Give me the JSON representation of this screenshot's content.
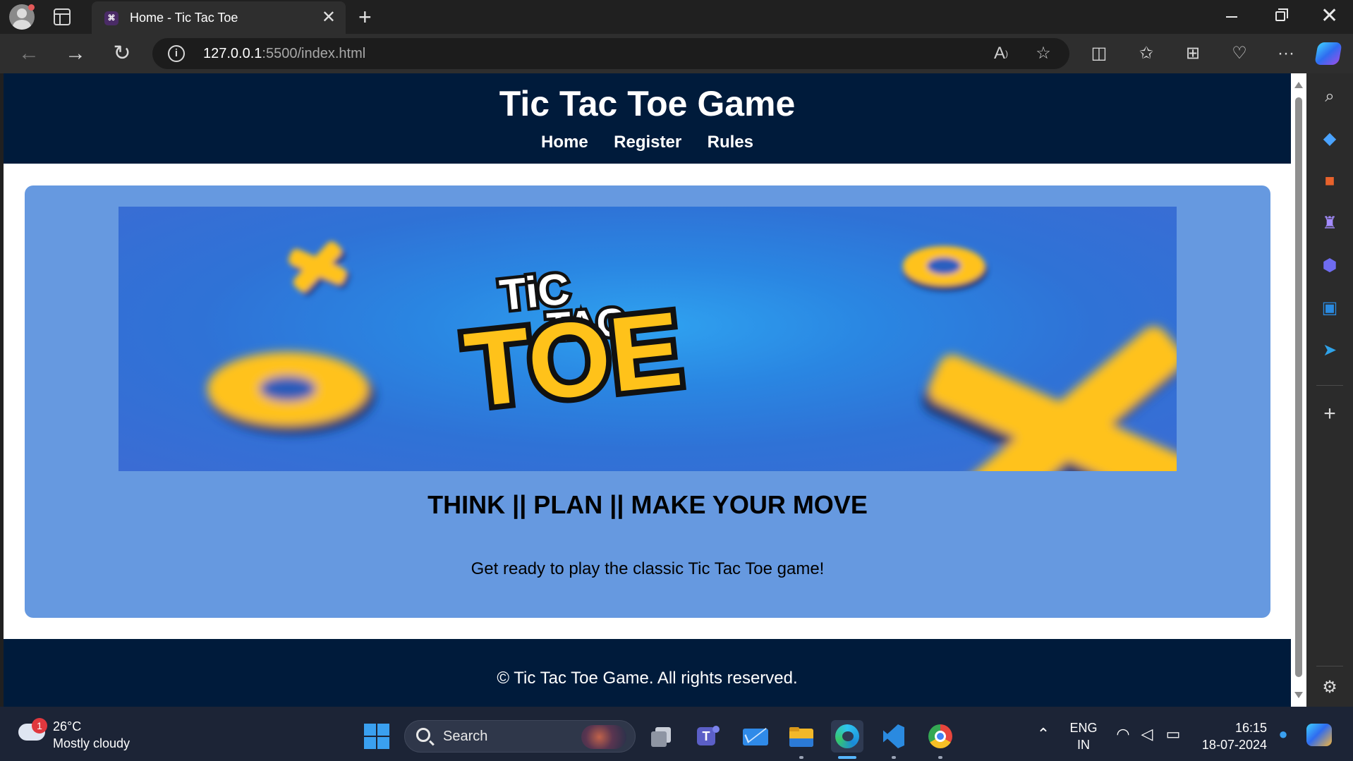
{
  "browser": {
    "tab_title": "Home - Tic Tac Toe",
    "tab_favicon": "⌘",
    "new_tab_glyph": "+",
    "close_tab_glyph": "✕",
    "url_host": "127.0.0.1",
    "url_rest": ":5500/index.html",
    "window_close_glyph": "✕",
    "back_glyph": "←",
    "forward_glyph": "→",
    "reload_glyph": "↻",
    "info_glyph": "i",
    "more_glyph": "···"
  },
  "site": {
    "title": "Tic Tac Toe Game",
    "nav": [
      "Home",
      "Register",
      "Rules"
    ],
    "banner": {
      "logo_line1": "TiC",
      "logo_line2": "TAC",
      "logo_line3": "TOE",
      "x_mark": "X",
      "o_mark": "O"
    },
    "tagline": "THINK || PLAN || MAKE YOUR MOVE",
    "intro": "Get ready to play the classic Tic Tac Toe game!",
    "footer": "© Tic Tac Toe Game. All rights reserved."
  },
  "taskbar": {
    "weather_badge": "1",
    "weather_temp": "26°C",
    "weather_desc": "Mostly cloudy",
    "search_label": "Search",
    "lang_line1": "ENG",
    "lang_line2": "IN",
    "time": "16:15",
    "date": "18-07-2024"
  },
  "colors": {
    "header_bg": "#001b3b",
    "hero_bg": "#6699e0",
    "logo_yellow": "#ffc21a"
  }
}
